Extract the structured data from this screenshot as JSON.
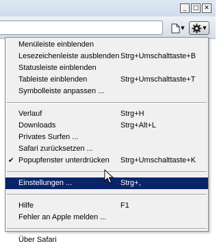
{
  "window": {
    "minimize_glyph": "_",
    "maximize_glyph": "□",
    "close_glyph": "✕"
  },
  "toolbar": {
    "page_icon": "page-icon",
    "gear_icon": "gear-icon",
    "dropdown_glyph": "▼"
  },
  "menu": {
    "group1": [
      {
        "label": "Menüleiste einblenden",
        "shortcut": ""
      },
      {
        "label": "Lesezeichenleiste ausblenden",
        "shortcut": "Strg+Umschalttaste+B"
      },
      {
        "label": "Statusleiste einblenden",
        "shortcut": ""
      },
      {
        "label": "Tableiste einblenden",
        "shortcut": "Strg+Umschalttaste+T"
      },
      {
        "label": "Symbolleiste anpassen ...",
        "shortcut": ""
      }
    ],
    "group2": [
      {
        "label": "Verlauf",
        "shortcut": "Strg+H"
      },
      {
        "label": "Downloads",
        "shortcut": "Strg+Alt+L"
      },
      {
        "label": "Privates Surfen ...",
        "shortcut": ""
      },
      {
        "label": "Safari zurücksetzen ...",
        "shortcut": ""
      },
      {
        "label": "Popupfenster unterdrücken",
        "shortcut": "Strg+Umschalttaste+K",
        "checked": true,
        "check_glyph": "✔"
      }
    ],
    "group3": [
      {
        "label": "Einstellungen ...",
        "shortcut": "Strg+,",
        "highlighted": true
      }
    ],
    "group4": [
      {
        "label": "Hilfe",
        "shortcut": "F1"
      },
      {
        "label": "Fehler an Apple melden ...",
        "shortcut": ""
      }
    ],
    "group5": [
      {
        "label": "Über Safari",
        "shortcut": ""
      }
    ]
  },
  "colors": {
    "highlight_bg": "#0a246a",
    "menu_bg": "#f0f0f0"
  }
}
